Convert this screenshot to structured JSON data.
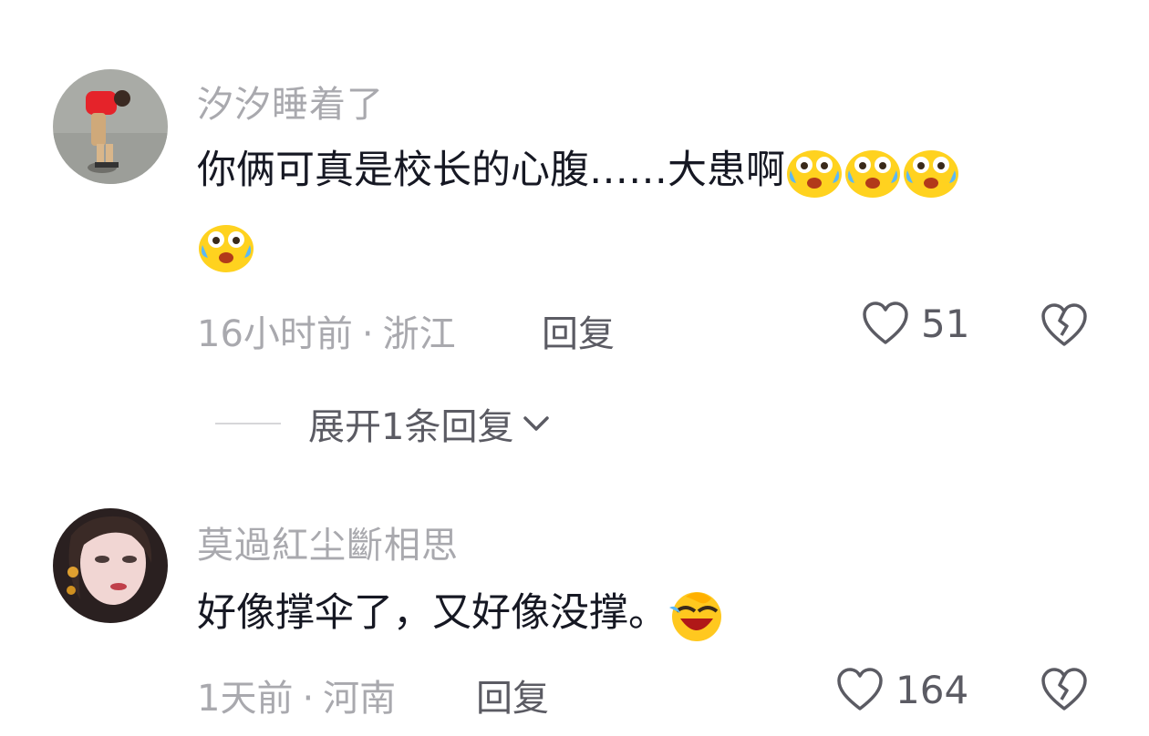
{
  "comments": [
    {
      "username": "汐汐睡着了",
      "text": "你俩可真是校长的心腹……大患啊",
      "emoji": "crying-face-icon",
      "time": "16小时前",
      "location": "浙江",
      "reply_label": "回复",
      "likes": "51",
      "expand_label": "展开1条回复"
    },
    {
      "username": "莫過紅尘斷相思",
      "text": "好像撑伞了，又好像没撑。",
      "emoji": "laughing-face-icon",
      "time": "1天前",
      "location": "河南",
      "reply_label": "回复",
      "likes": "164"
    }
  ],
  "separator": "·"
}
